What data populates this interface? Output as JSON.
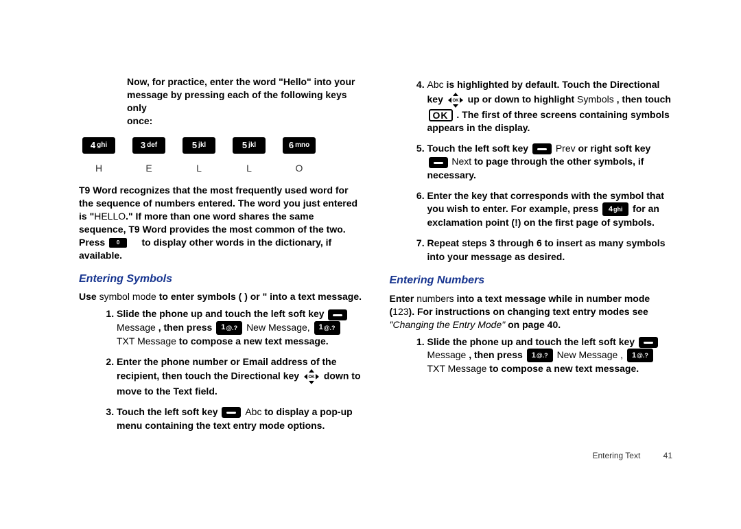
{
  "left": {
    "practice_line1": "Now, for practice, enter the word \"Hello\" into your",
    "practice_line2": "message by pressing each of the following keys only",
    "practice_line3": "once:",
    "keys": [
      {
        "num": "4",
        "sub": "ghi",
        "letter": "H"
      },
      {
        "num": "3",
        "sub": "def",
        "letter": "E"
      },
      {
        "num": "5",
        "sub": "jkl",
        "letter": "L"
      },
      {
        "num": "5",
        "sub": "jkl",
        "letter": "L"
      },
      {
        "num": "6",
        "sub": "mno",
        "letter": "O"
      }
    ],
    "t9_para": "T9 Word recognizes that the most frequently used word for the sequence of numbers entered. The word you just entered is \"HELLO.\" If more than one word shares the same sequence, T9 Word provides the most common of the two. Press           to display other words in the dictionary, if available.",
    "section1_title": "Entering Symbols",
    "symbols_intro_a": "Use ",
    "symbols_intro_b": "symbol mode",
    "symbols_intro_c": " to enter symbols ( ) or \" into a text message.",
    "li1_a": "Slide the phone up and touch the left soft key ",
    "li1_msg": "Message",
    "li1_b": " , then press ",
    "li1_newmsg": " New Message, ",
    "li1_txt": " TXT ",
    "li1_msg2": "Message",
    "li1_c": " to compose a new text message.",
    "li2_a": "Enter the phone number or Email address of the recipient, then touch the Directional key ",
    "li2_b": " down to move to the Text field.",
    "li3_a": "Touch the left soft key ",
    "li3_abc": " Abc ",
    "li3_b": "to display a pop-up menu containing the text entry mode options."
  },
  "right": {
    "li4_a": "Abc",
    "li4_b": " is highlighted by default. Touch the Directional key ",
    "li4_c": " up or down to highlight ",
    "li4_sym": "Symbols",
    "li4_d": " , then touch ",
    "li4_e": " . The first of three screens containing symbols appears in the display.",
    "li5_a": "Touch the left soft key ",
    "li5_prev": " Prev ",
    "li5_b": "or right soft key ",
    "li5_next": "Next",
    "li5_c": " to page through the other symbols, if necessary.",
    "li6_a": "Enter the key that corresponds with the symbol that you wish to enter. For example, press ",
    "li6_b": " for an exclamation point (!) on the first page of symbols.",
    "li7": "Repeat steps 3 through 6 to insert as many symbols into your message as desired.",
    "section2_title": "Entering Numbers",
    "num_intro_a": "Enter ",
    "num_intro_b": "numbers",
    "num_intro_c": " into a text message while in number mode (",
    "num_intro_d": "123",
    "num_intro_e": "). For instructions on changing text entry modes see ",
    "num_intro_f": "\"Changing the Entry Mode\"",
    "num_intro_g": " on page 40.",
    "rli1_a": "Slide the phone up and touch the left soft key ",
    "rli1_msg": "Message",
    "rli1_b": " , then press ",
    "rli1_newmsg": " New Message , ",
    "rli1_txt": " TXT ",
    "rli1_msg2": "Message",
    "rli1_c": " to compose a new text message."
  },
  "keylabels": {
    "onekey_big": "1",
    "onekey_sub": "@.?",
    "fourkey_big": "4",
    "fourkey_sub": "ghi",
    "nav_label": "0"
  },
  "footer": {
    "section": "Entering Text",
    "page": "41"
  }
}
